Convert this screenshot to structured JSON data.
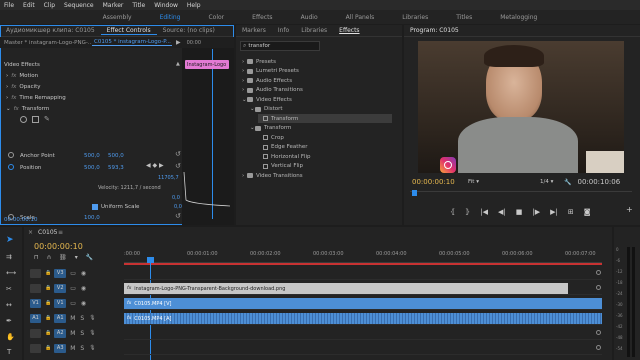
{
  "menu": [
    "File",
    "Edit",
    "Clip",
    "Sequence",
    "Marker",
    "Title",
    "Window",
    "Help"
  ],
  "workspaces": [
    {
      "label": "Assembly",
      "active": false
    },
    {
      "label": "Editing",
      "active": true
    },
    {
      "label": "Color",
      "active": false
    },
    {
      "label": "Effects",
      "active": false
    },
    {
      "label": "Audio",
      "active": false
    },
    {
      "label": "All Panels",
      "active": false
    },
    {
      "label": "Libraries",
      "active": false
    },
    {
      "label": "Titles",
      "active": false
    },
    {
      "label": "Metalogging",
      "active": false
    }
  ],
  "effect_controls": {
    "tabs": [
      "Аудиомикшер клипа: C0105",
      "Effect Controls",
      "Source: (no clips)"
    ],
    "master": "Master * instagram-Logo-PNG-...",
    "clip_name": "C0105 * instagram-Logo-P...",
    "section": "Video Effects",
    "time_marker": "00:00",
    "mini_clip": "Instagram-Logo",
    "motion": "Motion",
    "opacity": "Opacity",
    "time_remap": "Time Remapping",
    "transform": "Transform",
    "anchor_label": "Anchor Point",
    "anchor_x": "500,0",
    "anchor_y": "500,0",
    "position_label": "Position",
    "position_x": "500,0",
    "position_y": "593,3",
    "graph_max": "11705,7",
    "graph_zero": "0,0",
    "velocity": "Velocity: 1211,7 / second",
    "graph_low": "0,0",
    "uniform_scale": "Uniform Scale",
    "scale_label": "Scale",
    "scale_val": "100,0",
    "extra_val": "100,0",
    "timecode": "00:00:00:10"
  },
  "effects": {
    "tabs": [
      "Markers",
      "Info",
      "Libraries",
      "Effects"
    ],
    "search": "transfor",
    "items": [
      {
        "label": "Presets",
        "indent": 0,
        "type": "folder"
      },
      {
        "label": "Lumetri Presets",
        "indent": 0,
        "type": "folder"
      },
      {
        "label": "Audio Effects",
        "indent": 0,
        "type": "folder"
      },
      {
        "label": "Audio Transitions",
        "indent": 0,
        "type": "folder"
      },
      {
        "label": "Video Effects",
        "indent": 0,
        "type": "folder"
      },
      {
        "label": "Distort",
        "indent": 1,
        "type": "folder"
      },
      {
        "label": "Transform",
        "indent": 2,
        "type": "preset",
        "selected": true
      },
      {
        "label": "Transform",
        "indent": 1,
        "type": "folder"
      },
      {
        "label": "Crop",
        "indent": 2,
        "type": "preset"
      },
      {
        "label": "Edge Feather",
        "indent": 2,
        "type": "preset"
      },
      {
        "label": "Horizontal Flip",
        "indent": 2,
        "type": "preset"
      },
      {
        "label": "Vertical Flip",
        "indent": 2,
        "type": "preset"
      },
      {
        "label": "Video Transitions",
        "indent": 0,
        "type": "folder"
      }
    ]
  },
  "program": {
    "title": "Program: C0105",
    "timecode": "00:00:00:10",
    "fit": "Fit",
    "quality": "1/4",
    "duration": "00:00:10:06"
  },
  "timeline": {
    "seq_tab": "C0105",
    "timecode": "00:00:00:10",
    "ruler": [
      ":00:00",
      "00:00:01:00",
      "00:00:02:00",
      "00:00:03:00",
      "00:00:04:00",
      "00:00:05:00",
      "00:00:06:00",
      "00:00:07:00"
    ],
    "tracks": [
      {
        "name": "V3",
        "kind": "video"
      },
      {
        "name": "V2",
        "kind": "video"
      },
      {
        "name": "V1",
        "kind": "video",
        "target": "V1"
      },
      {
        "name": "A1",
        "kind": "audio",
        "target": "A1"
      },
      {
        "name": "A2",
        "kind": "audio"
      },
      {
        "name": "A3",
        "kind": "audio"
      }
    ],
    "clips": [
      {
        "label": "instagram-Logo-PNG-Transparent-Background-download.png",
        "track": "V2",
        "color": "#c6c6c6",
        "text": "#222"
      },
      {
        "label": "C0105.MP4 [V]",
        "track": "V1",
        "color": "#4d8fd6",
        "text": "#fff"
      },
      {
        "label": "C0105.MP4 [A]",
        "track": "A1",
        "color": "#4d8fd6",
        "text": "#fff"
      }
    ],
    "meter_labels": [
      "0",
      "-6",
      "-12",
      "-18",
      "-24",
      "-30",
      "-36",
      "-42",
      "-48",
      "-54"
    ]
  }
}
